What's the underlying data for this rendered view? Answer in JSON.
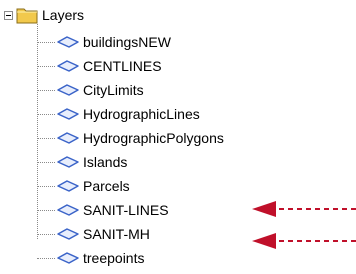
{
  "tree": {
    "root": {
      "label": "Layers",
      "expanded": true,
      "expander_icon": "minus-box-icon",
      "folder_icon": "folder-icon"
    },
    "items": [
      {
        "label": "buildingsNEW",
        "icon": "layer-icon"
      },
      {
        "label": "CENTLINES",
        "icon": "layer-icon"
      },
      {
        "label": "CityLimits",
        "icon": "layer-icon"
      },
      {
        "label": "HydrographicLines",
        "icon": "layer-icon"
      },
      {
        "label": "HydrographicPolygons",
        "icon": "layer-icon"
      },
      {
        "label": "Islands",
        "icon": "layer-icon"
      },
      {
        "label": "Parcels",
        "icon": "layer-icon"
      },
      {
        "label": "SANIT-LINES",
        "icon": "layer-icon"
      },
      {
        "label": "SANIT-MH",
        "icon": "layer-icon"
      },
      {
        "label": "treepoints",
        "icon": "layer-icon"
      }
    ]
  },
  "annotations": {
    "arrow_color": "#c0102a",
    "arrow_style": "dashed",
    "pointing_at": [
      "SANIT-LINES",
      "SANIT-MH"
    ]
  },
  "colors": {
    "folder": "#f2c94c",
    "layer_icon": "#3a63c8",
    "tree_lines": "#8a8a8a"
  }
}
